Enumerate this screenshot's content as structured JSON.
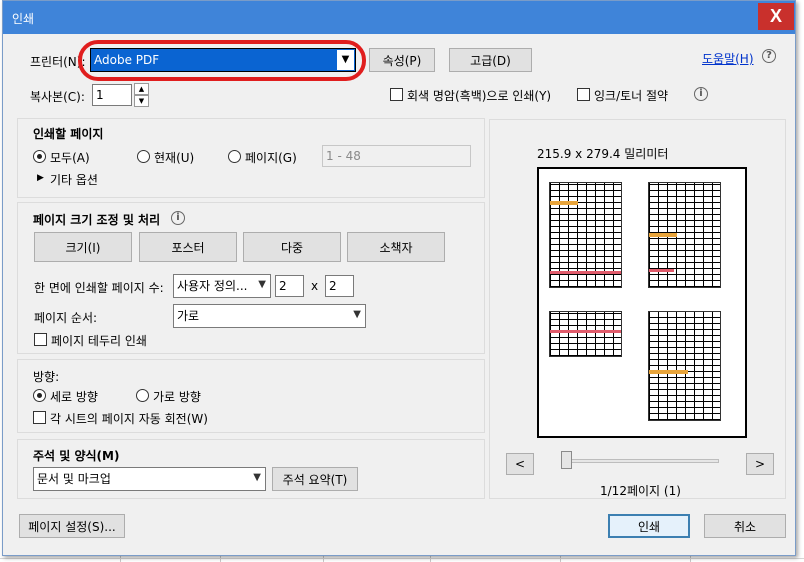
{
  "window": {
    "title": "인쇄",
    "close_glyph": "X"
  },
  "printer": {
    "label": "프린터(N):",
    "value": "Adobe PDF",
    "properties_btn": "속성(P)",
    "advanced_btn": "고급(D)",
    "help_link": "도움말(H)"
  },
  "copies": {
    "label": "복사본(C):",
    "value": "1",
    "grayscale": "회색 명암(흑백)으로 인쇄(Y)",
    "ink_save": "잉크/토너 절약"
  },
  "pages_to_print": {
    "heading": "인쇄할 페이지",
    "all": "모두(A)",
    "current": "현재(U)",
    "pages": "페이지(G)",
    "range": "1 - 48",
    "more_options": "기타 옵션"
  },
  "sizing": {
    "heading": "페이지 크기 조정 및 처리",
    "size_btn": "크기(I)",
    "poster_btn": "포스터",
    "multiple_btn": "다중",
    "booklet_btn": "소책자",
    "per_sheet_label": "한 면에 인쇄할 페이지 수:",
    "per_sheet_value": "사용자 정의...",
    "cols": "2",
    "times": "x",
    "rows": "2",
    "order_label": "페이지 순서:",
    "order_value": "가로",
    "border": "페이지 테두리 인쇄"
  },
  "orientation": {
    "heading": "방향:",
    "portrait": "세로 방향",
    "landscape": "가로 방향",
    "auto_rotate": "각 시트의 페이지 자동 회전(W)"
  },
  "comments": {
    "heading": "주석 및 양식(M)",
    "value": "문서 및 마크업",
    "summary_btn": "주석 요약(T)"
  },
  "preview": {
    "dimensions": "215.9 x 279.4 밀리미터",
    "prev": "<",
    "next": ">",
    "page_info": "1/12페이지 (1)",
    "slider_position": 0
  },
  "footer": {
    "page_setup": "페이지 설정(S)...",
    "print": "인쇄",
    "cancel": "취소"
  },
  "icons": {
    "info": "i",
    "help": "?",
    "arrow_down": "▼",
    "triangle_right": "▶",
    "spin_up": "▲",
    "spin_down": "▼"
  },
  "colors": {
    "titlebar": "#3f84d9",
    "close": "#c9302c",
    "highlight": "#e01e1e",
    "selection": "#0a64d2"
  }
}
